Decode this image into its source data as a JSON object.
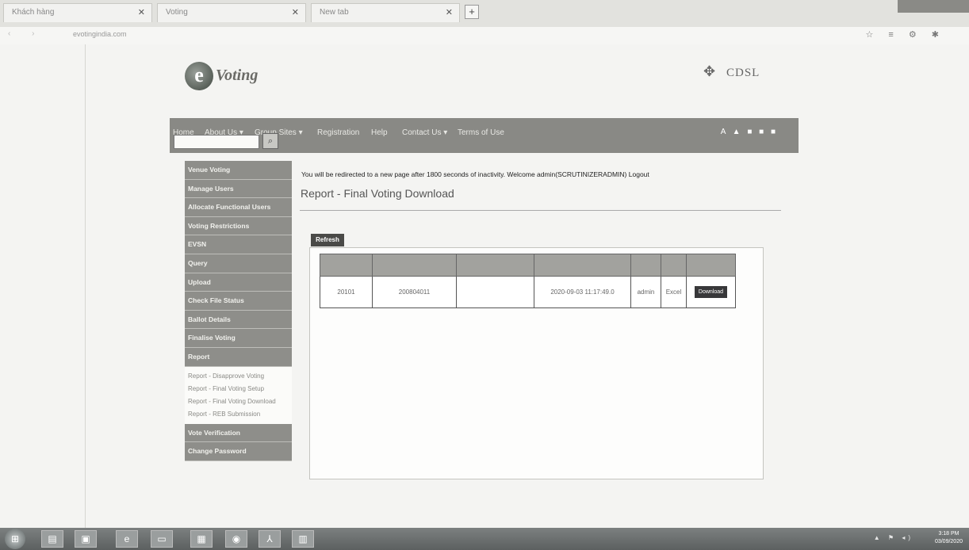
{
  "browser": {
    "tabs": [
      {
        "label": "Khách hàng"
      },
      {
        "label": "Voting"
      },
      {
        "label": "New tab"
      }
    ],
    "url": "evotingindia.com"
  },
  "header": {
    "logo_text": "Voting",
    "partner_logo": "CDSL"
  },
  "nav": {
    "items": [
      "Home",
      "About Us ▾",
      "Group Sites ▾",
      "Registration",
      "Help",
      "Contact Us ▾",
      "Terms of Use"
    ],
    "tools": "A- A A+",
    "search_placeholder": ""
  },
  "sidebar": {
    "items": [
      "Venue Voting",
      "Manage Users",
      "Allocate Functional Users",
      "Voting Restrictions",
      "EVSN",
      "Query",
      "Upload",
      "Check File Status",
      "Ballot Details",
      "Finalise Voting",
      "Report"
    ],
    "subitems": [
      "Report - Disapprove Voting",
      "Report - Final Voting Setup",
      "Report - Final Voting Download",
      "Report - REB Submission"
    ],
    "lower_items": [
      "Vote Verification",
      "Change Password"
    ]
  },
  "main": {
    "message": "You will be redirected to a new page after 1800 seconds of inactivity. Welcome admin(SCRUTINIZERADMIN)",
    "logout": "Logout",
    "title": "Report - Final Voting Download",
    "refresh_label": "Refresh",
    "table": {
      "headers": [
        "",
        "",
        "",
        "",
        "",
        "",
        ""
      ],
      "row": {
        "col1": "20101",
        "col2": "200804011",
        "col3": "",
        "col4": "2020-09-03 11:17:49.0",
        "col5": "admin",
        "col6": "Excel",
        "download_label": "Download"
      }
    }
  },
  "taskbar": {
    "time": "3:18 PM",
    "date": "03/09/2020"
  }
}
